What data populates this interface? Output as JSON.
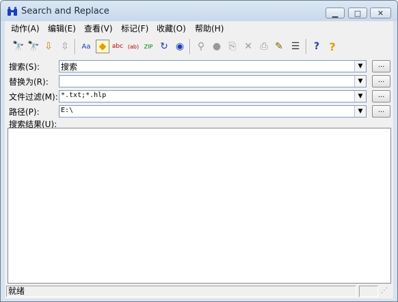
{
  "window": {
    "title": "Search and Replace",
    "icon": "binoculars-icon"
  },
  "window_controls": {
    "minimize": "▁",
    "maximize": "□",
    "close": "✕"
  },
  "menu": [
    "动作(A)",
    "编辑(E)",
    "查看(V)",
    "标记(F)",
    "收藏(O)",
    "帮助(H)"
  ],
  "toolbar": {
    "buttons": [
      {
        "name": "find-icon",
        "glyph": "🔭"
      },
      {
        "name": "find-next-icon",
        "glyph": "🔭"
      },
      {
        "name": "replace-icon",
        "glyph": "⇩"
      },
      {
        "name": "move-icon",
        "glyph": "⇳"
      },
      {
        "name": "find-case-icon",
        "glyph": "Aa"
      },
      {
        "name": "search-mode-icon",
        "glyph": "◆"
      },
      {
        "name": "find-abc-icon",
        "glyph": "abc"
      },
      {
        "name": "find-ab-icon",
        "glyph": "(ab)"
      },
      {
        "name": "find-zip-icon",
        "glyph": "ZIP"
      },
      {
        "name": "find-refresh-icon",
        "glyph": "↻"
      },
      {
        "name": "find-web-icon",
        "glyph": "◉"
      },
      {
        "name": "binoculars-gray-icon",
        "glyph": "⚲"
      },
      {
        "name": "stop-icon",
        "glyph": "●"
      },
      {
        "name": "copy-icon",
        "glyph": "⎘"
      },
      {
        "name": "delete-icon",
        "glyph": "✕"
      },
      {
        "name": "print-icon",
        "glyph": "⎙"
      },
      {
        "name": "notes-icon",
        "glyph": "✎"
      },
      {
        "name": "list-icon",
        "glyph": "☰"
      },
      {
        "name": "find-help-icon",
        "glyph": "?"
      },
      {
        "name": "help-icon",
        "glyph": "?"
      }
    ]
  },
  "fields": {
    "search": {
      "label": "搜索(S):",
      "value": "搜索"
    },
    "replace": {
      "label": "替换为(R):",
      "value": ""
    },
    "filter": {
      "label": "文件过滤(M):",
      "value": "*.txt;*.hlp"
    },
    "path": {
      "label": "路径(P):",
      "value": "E:\\"
    },
    "browse_label": "...",
    "dropdown_glyph": "▼"
  },
  "results": {
    "label": "搜索结果(U):"
  },
  "status": {
    "text": "就绪",
    "grip": "⋰"
  },
  "colors": {
    "titlebar": "#c8d9ec",
    "client": "#f0f0f0",
    "accent_blue": "#1a3cbf",
    "accent_yellow": "#f0c800"
  }
}
